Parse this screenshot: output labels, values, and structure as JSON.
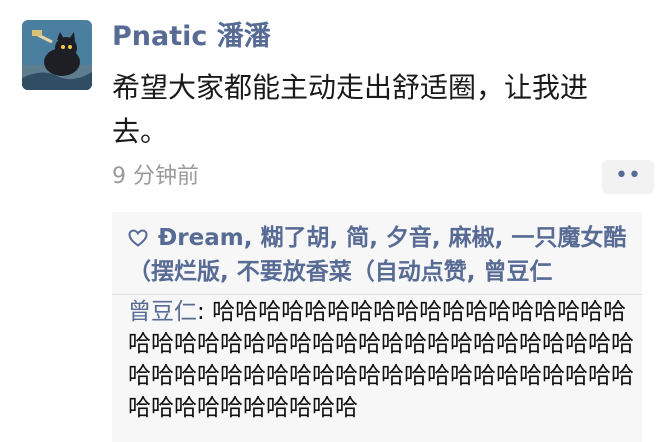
{
  "moment": {
    "author": "Pnatic 潘潘",
    "text": "希望大家都能主动走出舒适圈，让我进去。",
    "time": "9 分钟前",
    "more_label": "••"
  },
  "likes": {
    "names": "Đream, 糊了胡, 简, 夕音, 麻椒, 一只魔女酷（摆烂版, 不要放香菜（自动点赞, 曾豆仁"
  },
  "comments": [
    {
      "author": "曾豆仁",
      "separator": ": ",
      "text": "哈哈哈哈哈哈哈哈哈哈哈哈哈哈哈哈哈哈哈哈哈哈哈哈哈哈哈哈哈哈哈哈哈哈哈哈哈哈哈哈哈哈哈哈哈哈哈哈哈哈哈哈哈哈哈哈哈哈哈哈哈哈哈哈哈哈哈哈哈哈哈哈"
    }
  ]
}
